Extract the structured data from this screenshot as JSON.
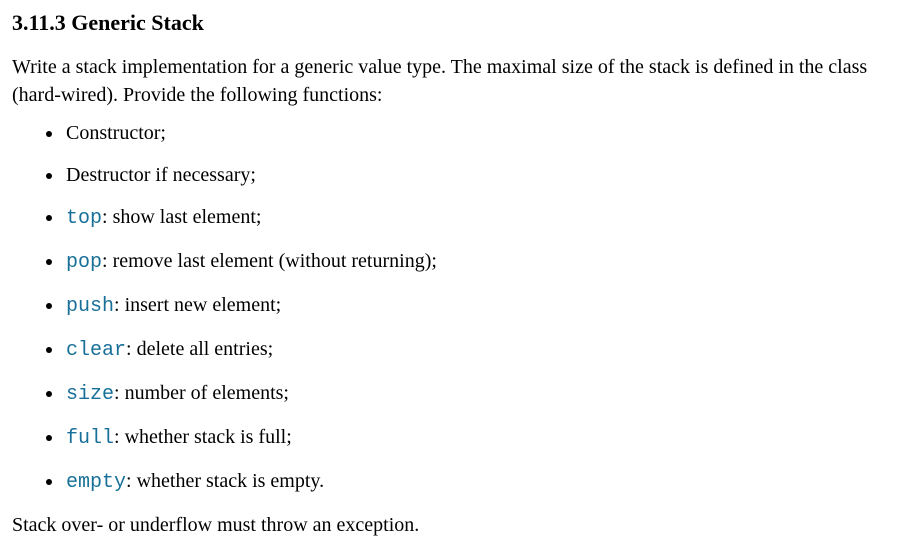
{
  "heading": "3.11.3 Generic Stack",
  "intro": "Write a stack implementation for a generic value type. The maximal size of the stack is defined in the class (hard-wired). Provide the following functions:",
  "items": {
    "constructor": "Constructor;",
    "destructor": "Destructor if necessary;",
    "top_code": "top",
    "top_desc": ": show last element;",
    "pop_code": "pop",
    "pop_desc": ": remove last element (without returning);",
    "push_code": "push",
    "push_desc": ": insert new element;",
    "clear_code": "clear",
    "clear_desc": ": delete all entries;",
    "size_code": "size",
    "size_desc": ": number of elements;",
    "full_code": "full",
    "full_desc": ": whether stack is full;",
    "empty_code": "empty",
    "empty_desc": ": whether stack is empty."
  },
  "footer": "Stack over- or underflow must throw an exception."
}
